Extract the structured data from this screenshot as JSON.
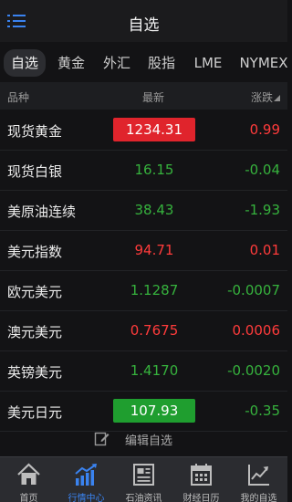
{
  "header": {
    "title": "自选"
  },
  "tabs": [
    {
      "label": "自选",
      "active": true
    },
    {
      "label": "黄金",
      "active": false
    },
    {
      "label": "外汇",
      "active": false
    },
    {
      "label": "股指",
      "active": false
    },
    {
      "label": "LME",
      "active": false
    },
    {
      "label": "NYMEX",
      "active": false
    }
  ],
  "columns": {
    "name": "品种",
    "price": "最新",
    "change": "涨跌"
  },
  "rows": [
    {
      "name": "现货黄金",
      "price": "1234.31",
      "change": "0.99",
      "direction": "up",
      "highlight": "red"
    },
    {
      "name": "现货白银",
      "price": "16.15",
      "change": "-0.04",
      "direction": "down",
      "highlight": ""
    },
    {
      "name": "美原油连续",
      "price": "38.43",
      "change": "-1.93",
      "direction": "down",
      "highlight": ""
    },
    {
      "name": "美元指数",
      "price": "94.71",
      "change": "0.01",
      "direction": "up",
      "highlight": ""
    },
    {
      "name": "欧元美元",
      "price": "1.1287",
      "change": "-0.0007",
      "direction": "down",
      "highlight": ""
    },
    {
      "name": "澳元美元",
      "price": "0.7675",
      "change": "0.0006",
      "direction": "up",
      "highlight": ""
    },
    {
      "name": "英镑美元",
      "price": "1.4170",
      "change": "-0.0020",
      "direction": "down",
      "highlight": ""
    },
    {
      "name": "美元日元",
      "price": "107.93",
      "change": "-0.35",
      "direction": "down",
      "highlight": "green"
    }
  ],
  "edit": {
    "label": "编辑自选"
  },
  "tabbar": [
    {
      "label": "首页",
      "icon": "home-icon",
      "active": false
    },
    {
      "label": "行情中心",
      "icon": "market-chart-icon",
      "active": true
    },
    {
      "label": "石油资讯",
      "icon": "news-icon",
      "active": false
    },
    {
      "label": "财经日历",
      "icon": "calendar-icon",
      "active": false
    },
    {
      "label": "我的自选",
      "icon": "trend-icon",
      "active": false
    }
  ],
  "colors": {
    "up": "#ff3b3b",
    "down": "#36b23d",
    "accent": "#3a83f0",
    "highlight_red": "#e0242c",
    "highlight_green": "#1f9e2f"
  }
}
